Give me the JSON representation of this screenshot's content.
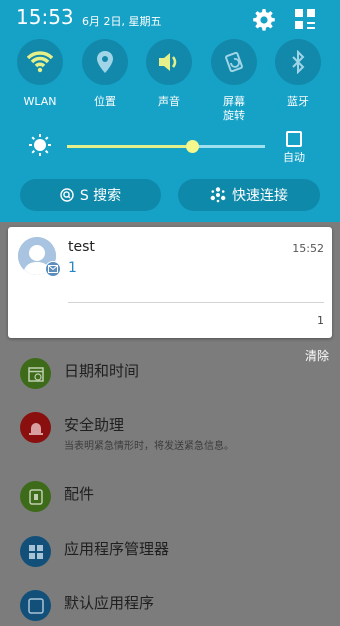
{
  "status": {
    "time": "15:53",
    "date": "6月 2日, 星期五"
  },
  "quick_toggles": [
    {
      "label": "WLAN",
      "icon": "wifi-icon"
    },
    {
      "label": "位置",
      "icon": "location-pin-icon"
    },
    {
      "label": "声音",
      "icon": "volume-icon"
    },
    {
      "label": "屏幕\n旋转",
      "icon": "screen-rotation-icon"
    },
    {
      "label": "蓝牙",
      "icon": "bluetooth-icon"
    }
  ],
  "brightness": {
    "level": 0.63,
    "auto_label": "自动",
    "auto_checked": false
  },
  "shortcuts": {
    "s_search": "S 搜索",
    "quick_connect": "快速连接"
  },
  "notification": {
    "title": "test",
    "body": "1",
    "time": "15:52",
    "count": "1"
  },
  "clear_label": "清除",
  "settings": [
    {
      "title": "日期和时间",
      "icon": "calendar-clock-icon",
      "color": "#3d6b1a"
    },
    {
      "title": "安全助理",
      "subtitle": "当表明紧急情形时，将发送紧急信息。",
      "icon": "alert-siren-icon",
      "color": "#8a1010"
    },
    {
      "title": "配件",
      "icon": "accessory-icon",
      "color": "#3d6b1a"
    },
    {
      "title": "应用程序管理器",
      "icon": "apps-grid-icon",
      "color": "#12507a"
    },
    {
      "title": "默认应用程序",
      "icon": "default-apps-icon",
      "color": "#12507a"
    }
  ],
  "colors": {
    "shade": "#16a1c7",
    "toggle_circle": "#1289ab",
    "wifi_on": "#e6f08a",
    "slider": "#e6f08a"
  }
}
